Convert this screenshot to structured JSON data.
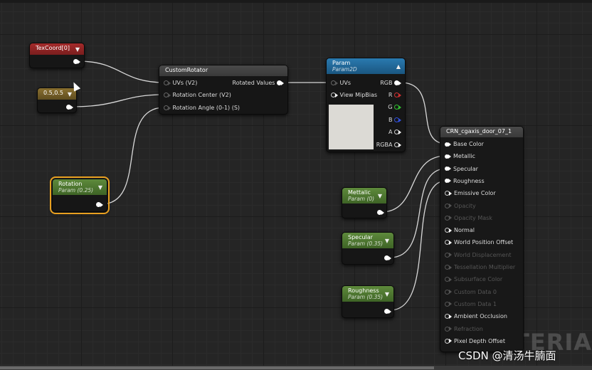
{
  "nodes": {
    "texcoord": {
      "title": "TexCoord[0]"
    },
    "const2": {
      "title": "0.5,0.5"
    },
    "rotation": {
      "title": "Rotation",
      "subtitle": "Param (0.25)"
    },
    "custom_rotator": {
      "title": "CustomRotator",
      "inputs": [
        "UVs (V2)",
        "Rotation Center (V2)",
        "Rotation Angle (0-1) (S)"
      ],
      "output": "Rotated Values"
    },
    "param2d": {
      "title": "Param",
      "subtitle": "Param2D",
      "inputs": [
        "UVs",
        "View MipBias"
      ],
      "outputs": [
        "RGB",
        "R",
        "G",
        "B",
        "A",
        "RGBA"
      ]
    },
    "metallic": {
      "title": "Mettalic",
      "subtitle": "Param (0)"
    },
    "specular": {
      "title": "Specular",
      "subtitle": "Param (0.35)"
    },
    "roughness": {
      "title": "Roughness",
      "subtitle": "Param (0.35)"
    },
    "material": {
      "title": "CRN_cgaxis_door_07_1",
      "inputs": [
        {
          "label": "Base Color",
          "active": true
        },
        {
          "label": "Metallic",
          "active": true
        },
        {
          "label": "Specular",
          "active": true
        },
        {
          "label": "Roughness",
          "active": true
        },
        {
          "label": "Emissive Color",
          "active": true
        },
        {
          "label": "Opacity",
          "active": false
        },
        {
          "label": "Opacity Mask",
          "active": false
        },
        {
          "label": "Normal",
          "active": true
        },
        {
          "label": "World Position Offset",
          "active": true
        },
        {
          "label": "World Displacement",
          "active": false
        },
        {
          "label": "Tessellation Multiplier",
          "active": false
        },
        {
          "label": "Subsurface Color",
          "active": false
        },
        {
          "label": "Custom Data 0",
          "active": false
        },
        {
          "label": "Custom Data 1",
          "active": false
        },
        {
          "label": "Ambient Occlusion",
          "active": true
        },
        {
          "label": "Refraction",
          "active": false
        },
        {
          "label": "Pixel Depth Offset",
          "active": true
        }
      ]
    }
  },
  "pin_colors": {
    "R": "#d03030",
    "G": "#30c030",
    "B": "#3050e0"
  },
  "background_text": "MATERIA",
  "watermark": "CSDN @清汤牛腩面"
}
